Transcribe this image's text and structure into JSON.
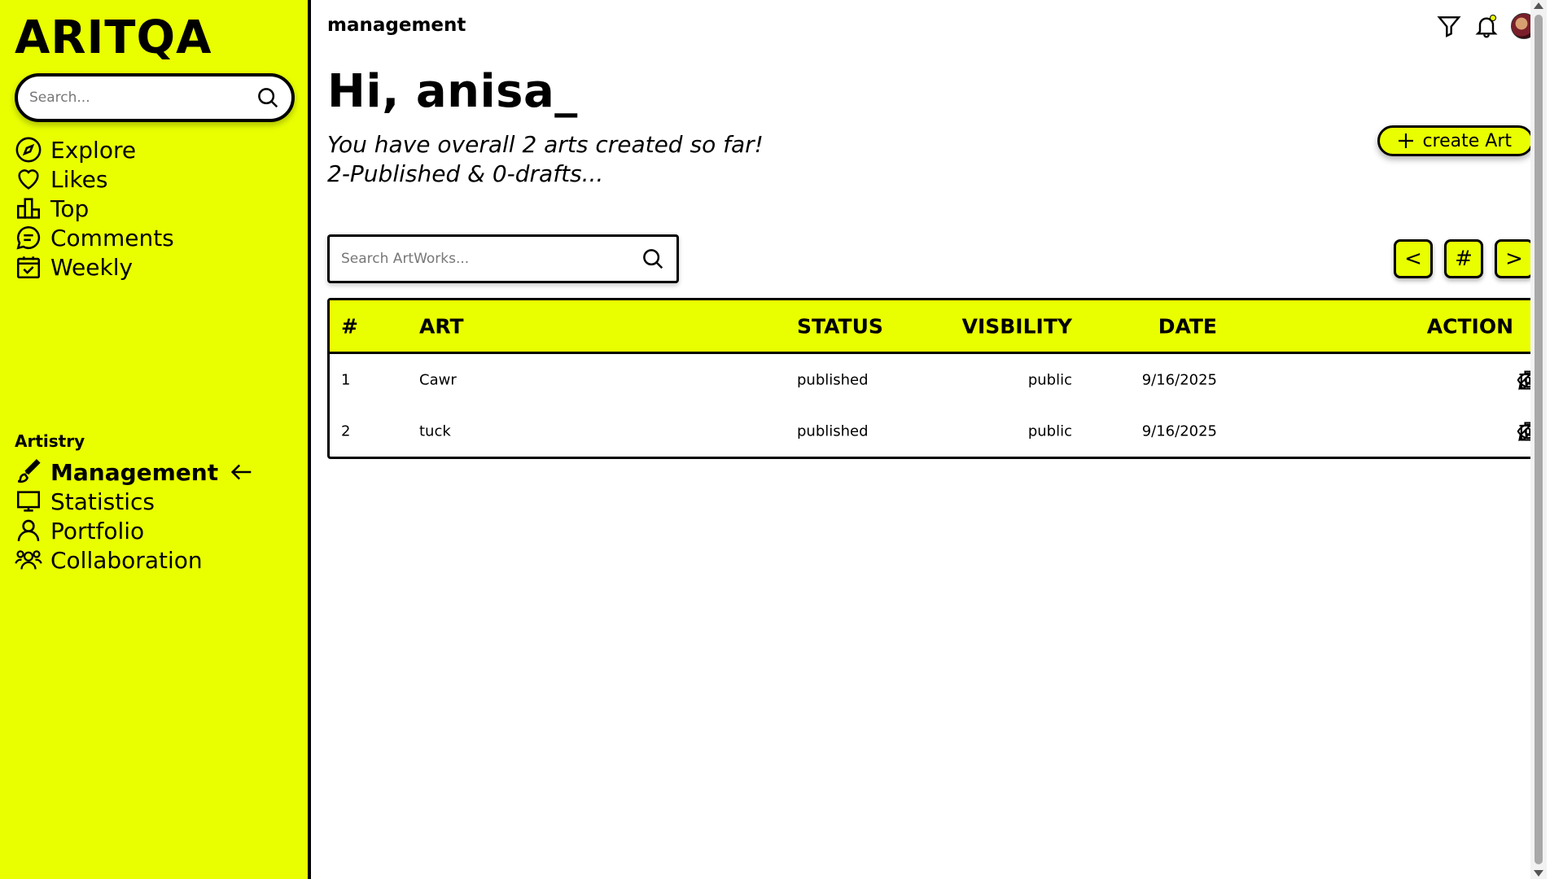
{
  "app": {
    "logo": "ARITQA"
  },
  "sidebar": {
    "search_placeholder": "Search...",
    "nav": [
      {
        "label": "Explore",
        "icon": "compass-icon"
      },
      {
        "label": "Likes",
        "icon": "heart-icon"
      },
      {
        "label": "Top",
        "icon": "podium-icon"
      },
      {
        "label": "Comments",
        "icon": "comment-icon"
      },
      {
        "label": "Weekly",
        "icon": "calendar-icon"
      }
    ],
    "section_label": "Artistry",
    "artistry": [
      {
        "label": "Management",
        "icon": "brush-icon",
        "active": true
      },
      {
        "label": "Statistics",
        "icon": "presentation-icon"
      },
      {
        "label": "Portfolio",
        "icon": "user-icon"
      },
      {
        "label": "Collaboration",
        "icon": "users-icon"
      }
    ]
  },
  "header": {
    "title": "management"
  },
  "main": {
    "greeting": "Hi, anisa_",
    "summary_line1": "You have overall 2 arts created so far!",
    "summary_line2": "2-Published & 0-drafts...",
    "create_label": "create Art",
    "search_placeholder": "Search ArtWorks...",
    "pager": {
      "prev": "<",
      "hash": "#",
      "next": ">"
    }
  },
  "table": {
    "columns": [
      "#",
      "ART",
      "STATUS",
      "VISBILITY",
      "DATE",
      "ACTION"
    ],
    "rows": [
      {
        "num": "1",
        "art": "Cawr",
        "status": "published",
        "visibility": "public",
        "date": "9/16/2025"
      },
      {
        "num": "2",
        "art": "tuck",
        "status": "published",
        "visibility": "public",
        "date": "9/16/2025"
      }
    ]
  },
  "colors": {
    "accent": "#e9ff00",
    "border": "#000000",
    "background": "#ffffff"
  }
}
